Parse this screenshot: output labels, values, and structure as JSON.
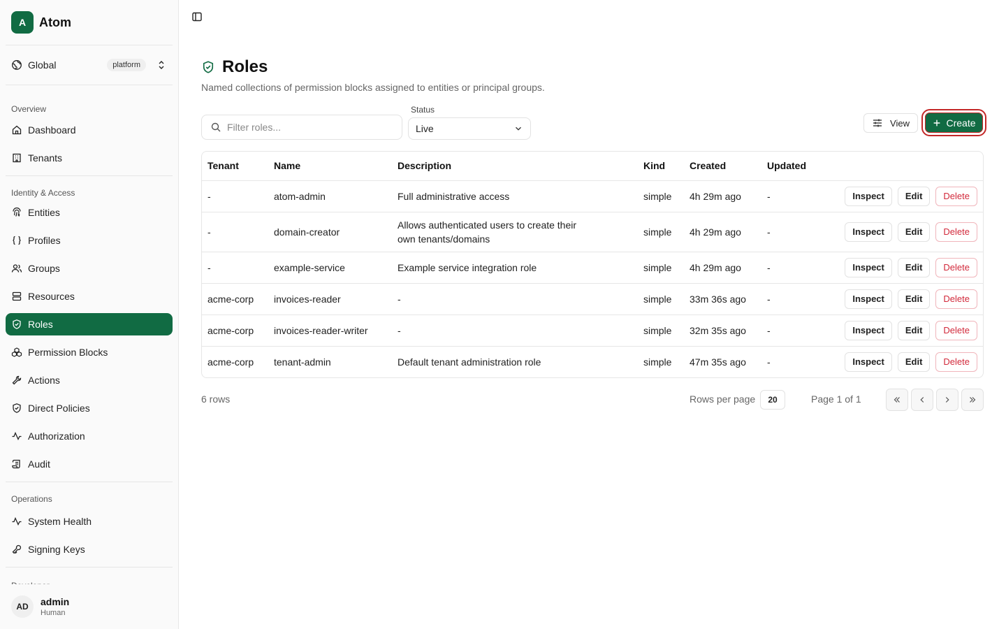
{
  "brand": {
    "logo_letter": "A",
    "name": "Atom",
    "accent_color": "#116b43"
  },
  "scope": {
    "label": "Global",
    "badge": "platform"
  },
  "nav": {
    "overview_label": "Overview",
    "overview": [
      {
        "label": "Dashboard",
        "icon": "home-icon"
      },
      {
        "label": "Tenants",
        "icon": "building-icon"
      }
    ],
    "identity_label": "Identity & Access",
    "identity": [
      {
        "label": "Entities",
        "icon": "fingerprint-icon"
      },
      {
        "label": "Profiles",
        "icon": "braces-icon"
      },
      {
        "label": "Groups",
        "icon": "users-icon"
      },
      {
        "label": "Resources",
        "icon": "server-icon"
      },
      {
        "label": "Roles",
        "icon": "shield-check-icon",
        "active": true
      },
      {
        "label": "Permission Blocks",
        "icon": "blocks-icon"
      },
      {
        "label": "Actions",
        "icon": "wrench-icon"
      },
      {
        "label": "Direct Policies",
        "icon": "shield-icon"
      },
      {
        "label": "Authorization",
        "icon": "activity-icon"
      },
      {
        "label": "Audit",
        "icon": "scroll-icon"
      }
    ],
    "operations_label": "Operations",
    "operations": [
      {
        "label": "System Health",
        "icon": "activity-icon"
      },
      {
        "label": "Signing Keys",
        "icon": "key-icon"
      }
    ],
    "developer_label": "Developer"
  },
  "user": {
    "initials": "AD",
    "name": "admin",
    "role": "Human"
  },
  "page": {
    "title": "Roles",
    "subtitle": "Named collections of permission blocks assigned to entities or principal groups."
  },
  "filters": {
    "search_placeholder": "Filter roles...",
    "status_label": "Status",
    "status_value": "Live",
    "view_label": "View",
    "create_label": "Create"
  },
  "table": {
    "columns": [
      "Tenant",
      "Name",
      "Description",
      "Kind",
      "Created",
      "Updated"
    ],
    "rows": [
      {
        "tenant": "-",
        "name": "atom-admin",
        "description": "Full administrative access",
        "kind": "simple",
        "created": "4h 29m ago",
        "updated": "-"
      },
      {
        "tenant": "-",
        "name": "domain-creator",
        "description": "Allows authenticated users to create their own tenants/domains",
        "kind": "simple",
        "created": "4h 29m ago",
        "updated": "-"
      },
      {
        "tenant": "-",
        "name": "example-service",
        "description": "Example service integration role",
        "kind": "simple",
        "created": "4h 29m ago",
        "updated": "-"
      },
      {
        "tenant": "acme-corp",
        "name": "invoices-reader",
        "description": "-",
        "kind": "simple",
        "created": "33m 36s ago",
        "updated": "-"
      },
      {
        "tenant": "acme-corp",
        "name": "invoices-reader-writer",
        "description": "-",
        "kind": "simple",
        "created": "32m 35s ago",
        "updated": "-"
      },
      {
        "tenant": "acme-corp",
        "name": "tenant-admin",
        "description": "Default tenant administration role",
        "kind": "simple",
        "created": "47m 35s ago",
        "updated": "-"
      }
    ],
    "row_actions": {
      "inspect": "Inspect",
      "edit": "Edit",
      "delete": "Delete"
    }
  },
  "pagination": {
    "rows_count": "6 rows",
    "rows_per_page_label": "Rows per page",
    "rows_per_page": "20",
    "page_info": "Page 1 of 1"
  }
}
